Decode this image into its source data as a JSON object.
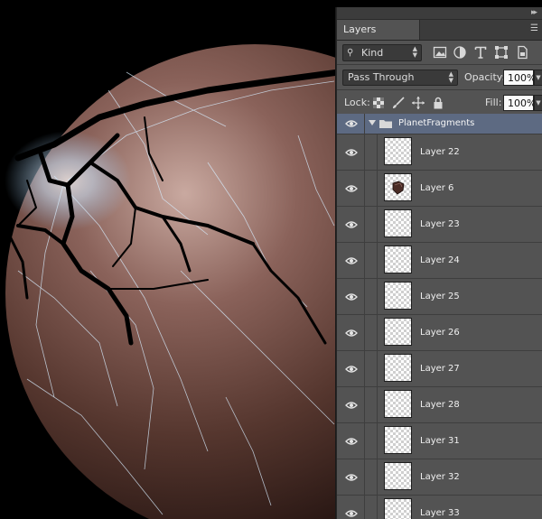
{
  "panel": {
    "collapse_icon": "double-chevron-right-icon",
    "tab_label": "Layers",
    "menu_icon": "panel-menu-icon",
    "filter": {
      "kind_label": "Kind",
      "icons": [
        "pixel-filter-icon",
        "adjustment-filter-icon",
        "type-filter-icon",
        "shape-filter-icon",
        "smart-object-filter-icon"
      ]
    },
    "blend_mode": "Pass Through",
    "opacity_label": "Opacity:",
    "opacity_value": "100%",
    "lock_label": "Lock:",
    "lock_icons": [
      "lock-transparent-icon",
      "lock-image-icon",
      "lock-position-icon",
      "lock-all-icon"
    ],
    "fill_label": "Fill:",
    "fill_value": "100%",
    "group": {
      "name": "PlanetFragments",
      "visible": true,
      "expanded": true
    },
    "layers": [
      {
        "name": "Layer 22",
        "visible": true
      },
      {
        "name": "Layer 6",
        "visible": true,
        "has_content": true
      },
      {
        "name": "Layer 23",
        "visible": true
      },
      {
        "name": "Layer 24",
        "visible": true
      },
      {
        "name": "Layer 25",
        "visible": true
      },
      {
        "name": "Layer 26",
        "visible": true
      },
      {
        "name": "Layer 27",
        "visible": true
      },
      {
        "name": "Layer 28",
        "visible": true
      },
      {
        "name": "Layer 31",
        "visible": true
      },
      {
        "name": "Layer 32",
        "visible": true
      },
      {
        "name": "Layer 33",
        "visible": true
      }
    ]
  },
  "colors": {
    "panel_bg": "#535353",
    "group_highlight": "#5d6a82",
    "planet_base": "#5a3a30",
    "crack_glow": "#bfe6ff"
  }
}
